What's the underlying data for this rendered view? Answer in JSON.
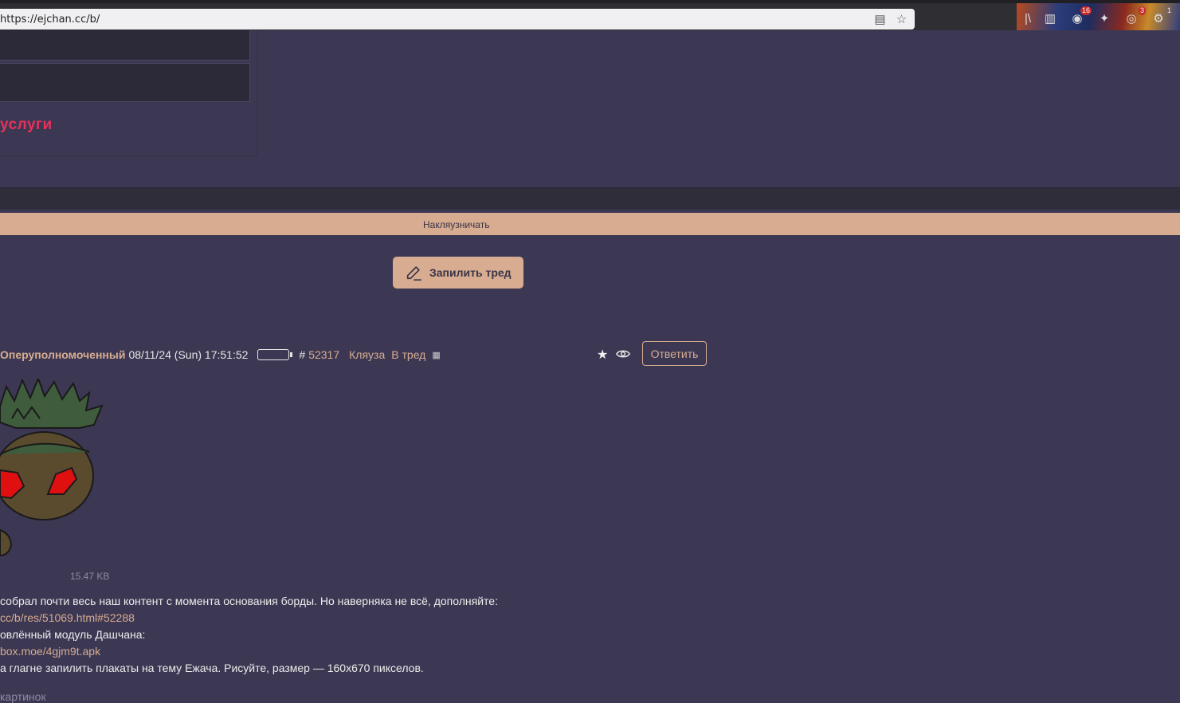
{
  "browser": {
    "url": "https://ejchan.cc/b/",
    "extensions": [
      {
        "name": "library-icon",
        "badge": ""
      },
      {
        "name": "sidebar-icon",
        "badge": ""
      },
      {
        "name": "ublock-icon",
        "badge": "16"
      },
      {
        "name": "extension-blue-icon",
        "badge": ""
      },
      {
        "name": "extension-red-icon",
        "badge": "3"
      },
      {
        "name": "extension-gear-icon",
        "badge": "1"
      }
    ]
  },
  "header": {
    "services_label": "услуги"
  },
  "banner": {
    "text": "Накляузничать"
  },
  "pin_button": {
    "label": "Запилить тред"
  },
  "post": {
    "poster_name": "Оперуполномоченный",
    "date": "08/11/24 (Sun) 17:51:52",
    "hash": "#",
    "number": "52317",
    "link_report": "Кляуза",
    "link_thread": "В тред",
    "qr_glyph": "▦",
    "reply_label": "Ответить",
    "file_size": "15.47 KB",
    "message": [
      "собрал почти весь наш контент с момента основания борды. Но наверняка не всё, дополняйте:",
      "cc/b/res/51069.html#52288",
      "овлённый модуль Дашчана:",
      "box.moe/4gjm9t.apk",
      "а глагне запилить плакаты на тему Ежача. Рисуйте, размер — 160х670 пикселов."
    ],
    "footer_text": "картинок"
  },
  "colors": {
    "background": "#3c3853",
    "accent": "#d7ac91",
    "services": "#e8305a"
  }
}
